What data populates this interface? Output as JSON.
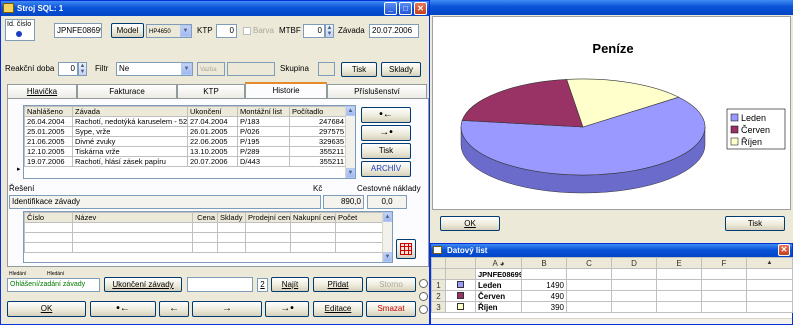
{
  "stroj_window": {
    "title": "Stroj SQL: 1",
    "id_cislo_label": "Id. číslo",
    "id_cislo_value": "JPNFE08699",
    "model_button": "Model",
    "model_value": "HP4650",
    "ktp_label": "KTP",
    "ktp_value": "0",
    "barva_label": "Barva",
    "mtbf_label": "MTBF",
    "mtbf_value": "0",
    "zavada_label": "Závada",
    "zavada_value": "20.07.2006",
    "reakcni_doba_label": "Reakční doba",
    "reakcni_doba_value": "0",
    "filtr_label": "Filtr",
    "filtr_value": "Ne",
    "vazba_placeholder": "Vazba",
    "skupina_label": "Skupina",
    "tisk_button": "Tisk",
    "sklady_button": "Sklady",
    "tabs": [
      "Hlavička",
      "Fakturace",
      "KTP",
      "Historie",
      "Příslušenství"
    ],
    "active_tab": "Historie",
    "history_table": {
      "columns": [
        "Nahlášeno",
        "Závada",
        "Ukončení",
        "Montážní list",
        "Počítadlo"
      ],
      "rows": [
        [
          "26.04.2004",
          "Rachotí, nedotýká karuselem - 52",
          "27.04.2004",
          "P/183",
          "247684"
        ],
        [
          "25.01.2005",
          "Sype, vrže",
          "26.01.2005",
          "P/026",
          "297575"
        ],
        [
          "21.06.2005",
          "Divné zvuky",
          "22.06.2005",
          "P/195",
          "329635"
        ],
        [
          "12.10.2005",
          "Tiskárna vrže",
          "13.10.2005",
          "P/289",
          "355211"
        ],
        [
          "19.07.2006",
          "Rachotí, hlásí zásek papíru",
          "20.07.2006",
          "D/443",
          "355211"
        ]
      ],
      "current_row_marker": "▸"
    },
    "side_buttons": {
      "prev": "•←",
      "next": "→•",
      "tisk": "Tisk",
      "archiv": "ARCHÍV"
    },
    "reseni_label": "Řešení",
    "kc_label": "Kč",
    "cestovne_label": "Cestovné náklady",
    "reseni_value": "Identifikace závady",
    "kc_value": "890,0",
    "cestovne_value": "0,0",
    "parts_table": {
      "columns": [
        "Číslo",
        "Název",
        "Cena",
        "Sklady",
        "Prodejní cena",
        "Nakupní cena",
        "Počet"
      ]
    },
    "small_label_1": "Hledání",
    "small_label_2": "Hledání",
    "status_value": "Ohlášení/zadání závady",
    "ukonceni_button": "Ukončení závady",
    "search_count": "2",
    "najit_button": "Najít",
    "pridat_button": "Přidat",
    "storno_button": "Storno",
    "ok_button": "OK",
    "nav_first": "•←",
    "nav_prev": "←",
    "nav_next": "→",
    "nav_last": "→•",
    "editace_button": "Editace",
    "smazat_button": "Smazat"
  },
  "chart_window": {
    "ok_button": "OK",
    "tisk_button": "Tisk",
    "chart_data": {
      "type": "pie",
      "title": "Peníze",
      "categories": [
        "Leden",
        "Červen",
        "Říjen"
      ],
      "values": [
        1490,
        490,
        390
      ],
      "legend": "right",
      "colors": [
        "#9999ff",
        "#993366",
        "#ffffcc"
      ]
    }
  },
  "datasheet": {
    "title": "Datový list",
    "columns": [
      "A",
      "B",
      "C",
      "D",
      "E",
      "F"
    ],
    "header_cell": "JPNFE08699",
    "rows": [
      {
        "num": "1",
        "label": "Leden",
        "value": "1490"
      },
      {
        "num": "2",
        "label": "Červen",
        "value": "490"
      },
      {
        "num": "3",
        "label": "Říjen",
        "value": "390"
      }
    ]
  }
}
